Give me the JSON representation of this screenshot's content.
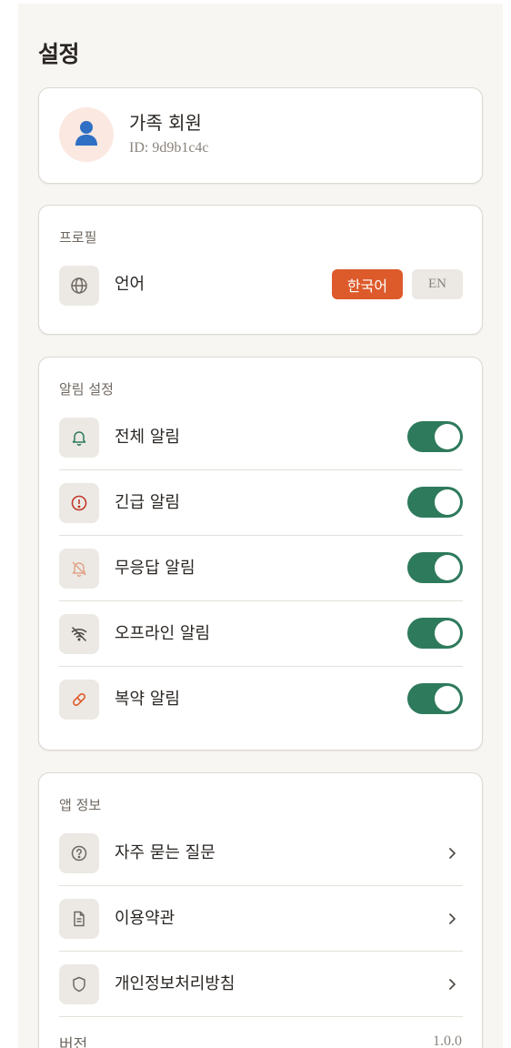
{
  "page_title": "설정",
  "user": {
    "name": "가족 회원",
    "id_text": "ID: 9d9b1c4c",
    "avatar_icon": "person-icon"
  },
  "profile": {
    "section_label": "프로필",
    "language": {
      "label": "언어",
      "icon": "globe-icon",
      "options": [
        "한국어",
        "EN"
      ],
      "selected": "한국어"
    }
  },
  "notifications": {
    "section_label": "알림 설정",
    "items": [
      {
        "label": "전체 알림",
        "icon": "bell-icon",
        "enabled": true
      },
      {
        "label": "긴급 알림",
        "icon": "alert-circle-icon",
        "enabled": true
      },
      {
        "label": "무응답 알림",
        "icon": "bell-off-icon",
        "enabled": true
      },
      {
        "label": "오프라인 알림",
        "icon": "wifi-off-icon",
        "enabled": true
      },
      {
        "label": "복약 알림",
        "icon": "pill-icon",
        "enabled": true
      }
    ]
  },
  "app_info": {
    "section_label": "앱 정보",
    "items": [
      {
        "label": "자주 묻는 질문",
        "icon": "help-circle-icon"
      },
      {
        "label": "이용약관",
        "icon": "document-icon"
      },
      {
        "label": "개인정보처리방침",
        "icon": "shield-icon"
      }
    ],
    "version_label": "버전",
    "version_value": "1.0.0"
  },
  "colors": {
    "accent": "#dd5a2b",
    "toggle_on": "#2e7a5c",
    "background": "#f8f6f2"
  }
}
